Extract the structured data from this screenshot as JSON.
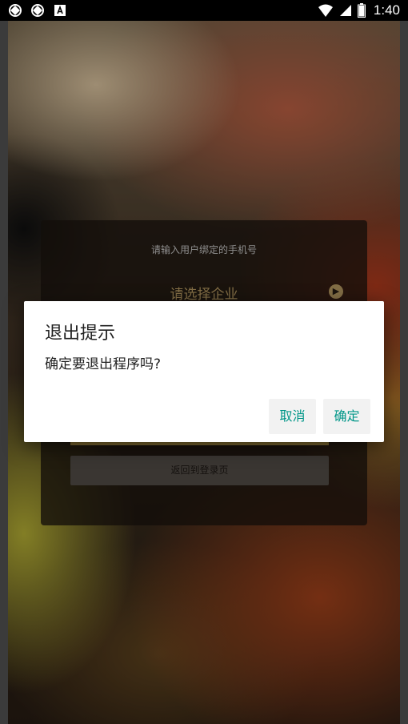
{
  "status_bar": {
    "time": "1:40",
    "icons": [
      "app-icon-1",
      "app-icon-2",
      "a-badge-icon",
      "wifi-icon",
      "cellular-icon",
      "battery-icon"
    ]
  },
  "login_card": {
    "phone_hint": "请输入用户绑定的手机号",
    "select_company": "请选择企业",
    "back_to_login": "返回到登录页"
  },
  "dialog": {
    "title": "退出提示",
    "message": "确定要退出程序吗?",
    "cancel_label": "取消",
    "confirm_label": "确定",
    "accent_color": "#009688"
  }
}
